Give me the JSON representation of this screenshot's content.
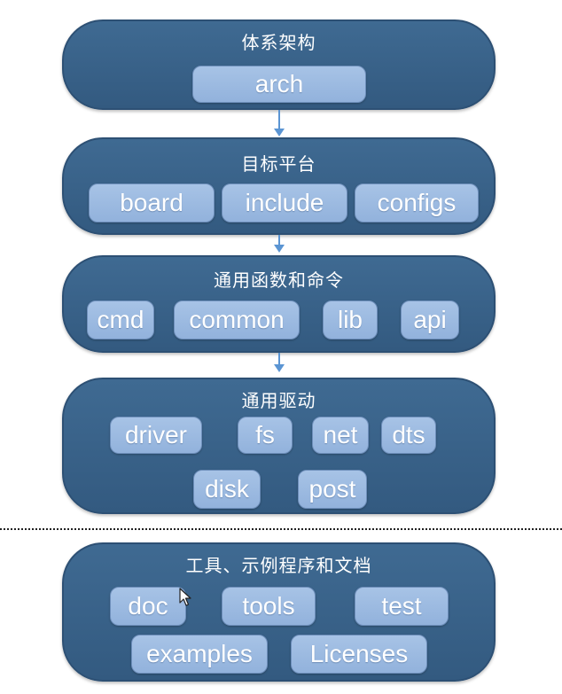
{
  "layers": [
    {
      "title": "体系架构",
      "modules": [
        "arch"
      ]
    },
    {
      "title": "目标平台",
      "modules": [
        "board",
        "include",
        "configs"
      ]
    },
    {
      "title": "通用函数和命令",
      "modules": [
        "cmd",
        "common",
        "lib",
        "api"
      ]
    },
    {
      "title": "通用驱动",
      "modules": [
        "driver",
        "fs",
        "net",
        "dts",
        "disk",
        "post"
      ]
    },
    {
      "title": "工具、示例程序和文档",
      "modules": [
        "doc",
        "tools",
        "test",
        "examples",
        "Licenses"
      ]
    }
  ],
  "colors": {
    "layer_fill": "#3a6590",
    "module_fill": "#9dbae1",
    "connector": "#5b95d3",
    "text": "#ffffff"
  },
  "icons": [
    "mouse-cursor-icon"
  ]
}
